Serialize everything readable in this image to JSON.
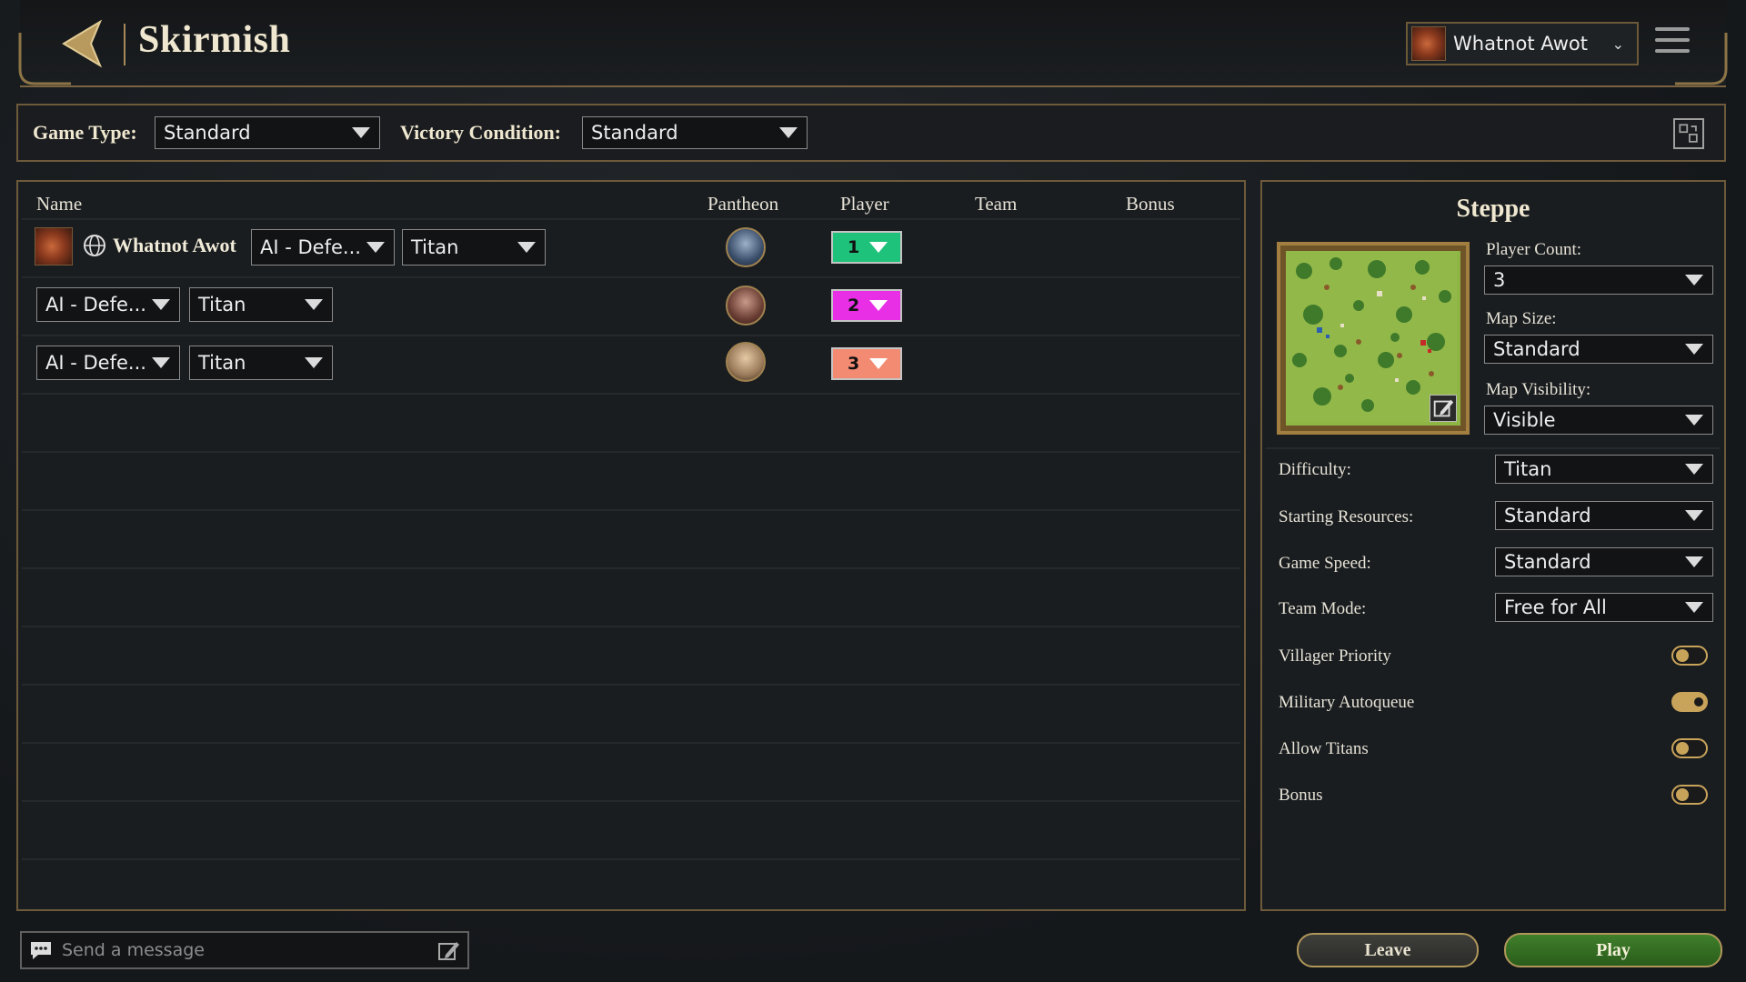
{
  "header": {
    "title": "Skirmish",
    "profile_name": "Whatnot Awot"
  },
  "filters": {
    "game_type_label": "Game Type:",
    "game_type_value": "Standard",
    "victory_label": "Victory Condition:",
    "victory_value": "Standard"
  },
  "players_table": {
    "headers": {
      "name": "Name",
      "pantheon": "Pantheon",
      "player": "Player",
      "team": "Team",
      "bonus": "Bonus"
    },
    "rows": [
      {
        "name": "Whatnot Awot",
        "ai": "AI - Defe...",
        "difficulty": "Titan",
        "player_num": "1",
        "color": "#1fc27a",
        "pantheon_color": "#3b4f6b"
      },
      {
        "ai": "AI - Defe...",
        "difficulty": "Titan",
        "player_num": "2",
        "color": "#e82fe6",
        "pantheon_color": "#6b3e34"
      },
      {
        "ai": "AI - Defe...",
        "difficulty": "Titan",
        "player_num": "3",
        "color": "#f38a72",
        "pantheon_color": "#9a7a5a"
      }
    ]
  },
  "settings": {
    "map_name": "Steppe",
    "player_count_label": "Player Count:",
    "player_count_value": "3",
    "map_size_label": "Map Size:",
    "map_size_value": "Standard",
    "map_visibility_label": "Map Visibility:",
    "map_visibility_value": "Visible",
    "difficulty_label": "Difficulty:",
    "difficulty_value": "Titan",
    "resources_label": "Starting Resources:",
    "resources_value": "Standard",
    "speed_label": "Game Speed:",
    "speed_value": "Standard",
    "team_mode_label": "Team Mode:",
    "team_mode_value": "Free for All",
    "toggles": [
      {
        "label": "Villager Priority",
        "on": false
      },
      {
        "label": "Military Autoqueue",
        "on": true
      },
      {
        "label": "Allow Titans",
        "on": false
      },
      {
        "label": "Bonus",
        "on": false
      }
    ]
  },
  "chat": {
    "placeholder": "Send a message"
  },
  "buttons": {
    "leave": "Leave",
    "play": "Play"
  },
  "colors": {
    "accent_gold": "#a5895a",
    "play_green": "#3f7f2a"
  }
}
